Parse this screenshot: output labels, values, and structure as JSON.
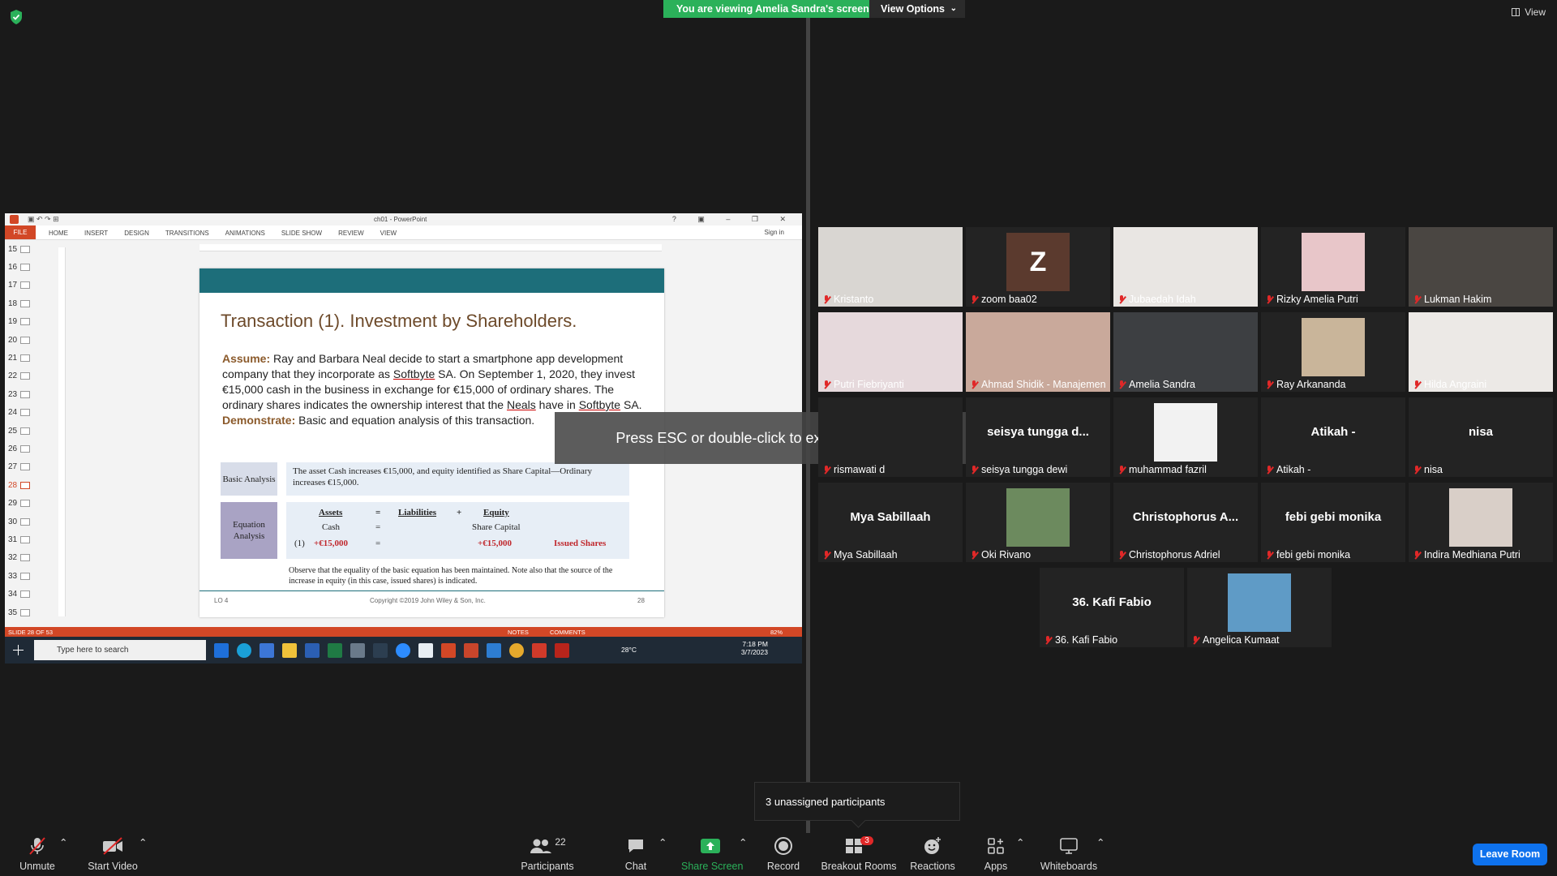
{
  "top_bar": {
    "viewing_banner": "You are viewing Amelia Sandra's screen",
    "view_options": "View Options",
    "view_button": "View"
  },
  "shared_screen": {
    "window_title": "ch01 - PowerPoint",
    "ribbon_tabs": [
      "FILE",
      "HOME",
      "INSERT",
      "DESIGN",
      "TRANSITIONS",
      "ANIMATIONS",
      "SLIDE SHOW",
      "REVIEW",
      "VIEW"
    ],
    "sign_in": "Sign in",
    "slide_numbers": [
      "15",
      "16",
      "17",
      "18",
      "19",
      "20",
      "21",
      "22",
      "23",
      "24",
      "25",
      "26",
      "27",
      "28",
      "29",
      "30",
      "31",
      "32",
      "33",
      "34",
      "35"
    ],
    "selected_slide": "28",
    "slide": {
      "title": "Transaction (1). Investment by Shareholders.",
      "assume_label": "Assume:",
      "assume_text_1": " Ray and Barbara Neal decide to start a smartphone app development company that they incorporate as ",
      "softbyte_1": "Softbyte",
      "assume_text_2": " SA. On September 1, 2020, they invest €15,000 cash in the business in exchange for €15,000 of ordinary shares. The ordinary shares indicates the ownership interest that the ",
      "neals": "Neals",
      "assume_text_3": " have in ",
      "softbyte_2": "Softbyte",
      "assume_text_4": " SA.",
      "demonstrate_label": "Demonstrate:",
      "demonstrate_text": " Basic and equation analysis of this transaction.",
      "basic_analysis_label": "Basic Analysis",
      "basic_analysis_text": "The asset Cash increases €15,000, and equity identified as Share Capital—Ordinary increases €15,000.",
      "equation_analysis_label": "Equation Analysis",
      "eq_assets": "Assets",
      "eq_equals": "=",
      "eq_liabilities": "Liabilities",
      "eq_plus": "+",
      "eq_equity": "Equity",
      "eq_cash": "Cash",
      "eq_share_capital": "Share Capital",
      "eq_row_num": "(1)",
      "eq_cash_val": "+€15,000",
      "eq_sc_val": "+€15,000",
      "eq_issued": "Issued Shares",
      "observe": "Observe that the equality of the basic equation has been maintained. Note also that the source of the increase in equity (in this case, issued shares) is indicated.",
      "footer_lo": "LO 4",
      "footer_copy": "Copyright ©2019 John Wiley & Son, Inc.",
      "footer_page": "28"
    },
    "status_bar": {
      "slide_of": "SLIDE 28 OF 53",
      "notes": "NOTES",
      "comments": "COMMENTS",
      "zoom": "82%"
    },
    "taskbar": {
      "search_placeholder": "Type here to search",
      "temperature": "28°C",
      "time": "7:18 PM",
      "date": "3/7/2023"
    }
  },
  "esc_toast": "Press ESC or double-click to exit full screen mode",
  "participants": [
    {
      "name": "Kristanto"
    },
    {
      "name": "zoom baa02",
      "initial": "Z"
    },
    {
      "name": "Jubaedah Idah"
    },
    {
      "name": "Rizky Amelia Putri"
    },
    {
      "name": "Lukman Hakim"
    },
    {
      "name": "Putri Fiebriyanti"
    },
    {
      "name": "Ahmad Shidik - Manajemen"
    },
    {
      "name": "Amelia Sandra"
    },
    {
      "name": "Ray Arkananda"
    },
    {
      "name": "Hilda Angraini"
    },
    {
      "name": "rismawati d"
    },
    {
      "name": "seisya tungga dewi",
      "display": "seisya tungga d..."
    },
    {
      "name": "muhammad fazril"
    },
    {
      "name": "Atikah -",
      "display": "Atikah -"
    },
    {
      "name": "nisa",
      "display": "nisa"
    },
    {
      "name": "Mya Sabillaah",
      "display": "Mya Sabillaah"
    },
    {
      "name": "Oki Rivano"
    },
    {
      "name": "Christophorus Adriel",
      "display": "Christophorus A..."
    },
    {
      "name": "febi gebi monika",
      "display": "febi gebi monika"
    },
    {
      "name": "Indira Medhiana Putri"
    },
    {
      "name": "36. Kafi Fabio",
      "display": "36. Kafi Fabio"
    },
    {
      "name": "Angelica Kumaat"
    }
  ],
  "unassigned_popup": "3 unassigned participants",
  "toolbar": {
    "unmute": "Unmute",
    "start_video": "Start Video",
    "participants": "Participants",
    "participants_count": "22",
    "chat": "Chat",
    "share_screen": "Share Screen",
    "record": "Record",
    "breakout_rooms": "Breakout Rooms",
    "breakout_badge": "3",
    "reactions": "Reactions",
    "apps": "Apps",
    "whiteboards": "Whiteboards",
    "leave_room": "Leave Room"
  },
  "colors": {
    "banner_green": "#2bb15a",
    "leave_blue": "#0e72ed",
    "ppt_accent": "#d24726",
    "active_speaker": "#c8e03c",
    "muted_red": "#e02828"
  }
}
